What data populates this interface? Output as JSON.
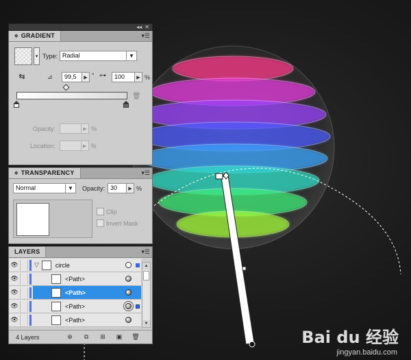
{
  "gradient_panel": {
    "tab_label": "GRADIENT",
    "type_label": "Type:",
    "type_value": "Radial",
    "angle_value": "99,5",
    "degree_symbol": "°",
    "aspect_value": "100",
    "aspect_unit": "%",
    "opacity_label": "Opacity:",
    "location_label": "Location:",
    "percent": "%"
  },
  "transparency_panel": {
    "tab_label": "TRANSPARENCY",
    "blend_mode": "Normal",
    "opacity_label": "Opacity:",
    "opacity_value": "30",
    "opacity_unit": "%",
    "clip_label": "Clip",
    "invert_mask_label": "Invert Mask"
  },
  "layers_panel": {
    "tab_label": "LAYERS",
    "rows": [
      {
        "name": "circle"
      },
      {
        "name": "<Path>"
      },
      {
        "name": "<Path>"
      },
      {
        "name": "<Path>"
      },
      {
        "name": "<Path>"
      }
    ],
    "footer_count": "4 Layers"
  },
  "watermark": {
    "logo": "Bai du 经验",
    "url": "jingyan.baidu.com"
  },
  "colors": {
    "accent_selection": "#2f8ee6",
    "layer_color": "#4f6fe8",
    "canvas_background": "#1b1b1b"
  }
}
